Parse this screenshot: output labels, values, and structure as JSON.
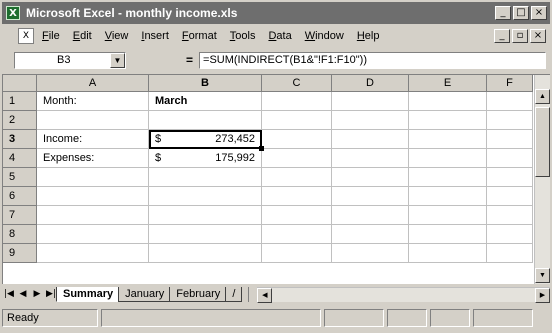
{
  "window": {
    "title": "Microsoft Excel - monthly income.xls",
    "app_icon": "X",
    "controls": [
      "_",
      "□",
      "×"
    ]
  },
  "menu": {
    "doc_icon": "X",
    "items": [
      "File",
      "Edit",
      "View",
      "Insert",
      "Format",
      "Tools",
      "Data",
      "Window",
      "Help"
    ],
    "doc_controls": [
      "_",
      "▫",
      "×"
    ]
  },
  "formula_bar": {
    "name_box": "B3",
    "equals": "=",
    "formula": "=SUM(INDIRECT(B1&\"!F1:F10\"))"
  },
  "grid": {
    "columns": [
      "A",
      "B",
      "C",
      "D",
      "E",
      "F"
    ],
    "rows": [
      "1",
      "2",
      "3",
      "4",
      "5",
      "6",
      "7",
      "8",
      "9"
    ],
    "cells": {
      "A1": "Month:",
      "B1": "March",
      "A3": "Income:",
      "B3_currency": "$",
      "B3_value": "273,452",
      "A4": "Expenses:",
      "B4_currency": "$",
      "B4_value": "175,992"
    },
    "active_cell": "B3"
  },
  "sheets": {
    "tabs": [
      "Summary",
      "January",
      "February",
      "/"
    ],
    "active": "Summary"
  },
  "status": {
    "text": "Ready"
  }
}
